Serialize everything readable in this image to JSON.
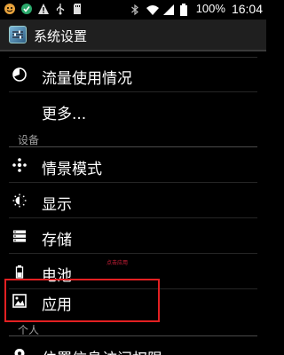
{
  "status_bar": {
    "battery_text": "100%",
    "time": "16:04",
    "icons_left": [
      "smiley-icon",
      "check-circle-icon",
      "warning-icon",
      "usb-icon",
      "sd-card-icon"
    ],
    "icons_right": [
      "bluetooth-icon",
      "wifi-icon",
      "signal-icon",
      "battery-icon"
    ]
  },
  "action_bar": {
    "title": "系统设置",
    "icon": "settings-app-icon"
  },
  "items": {
    "data_usage": "流量使用情况",
    "more": "更多...",
    "scenario_mode": "情景模式",
    "display": "显示",
    "storage": "存储",
    "battery": "电池",
    "apps": "应用",
    "location": "位置信息访问权限"
  },
  "sections": {
    "device": "设备",
    "personal": "个人"
  },
  "annotation": "点击应用",
  "colors": {
    "background": "#000000",
    "action_bar": "#1f1f1f",
    "highlight_box": "#e32022",
    "section_text": "#a0a0a0",
    "annotation": "#d4203a"
  }
}
